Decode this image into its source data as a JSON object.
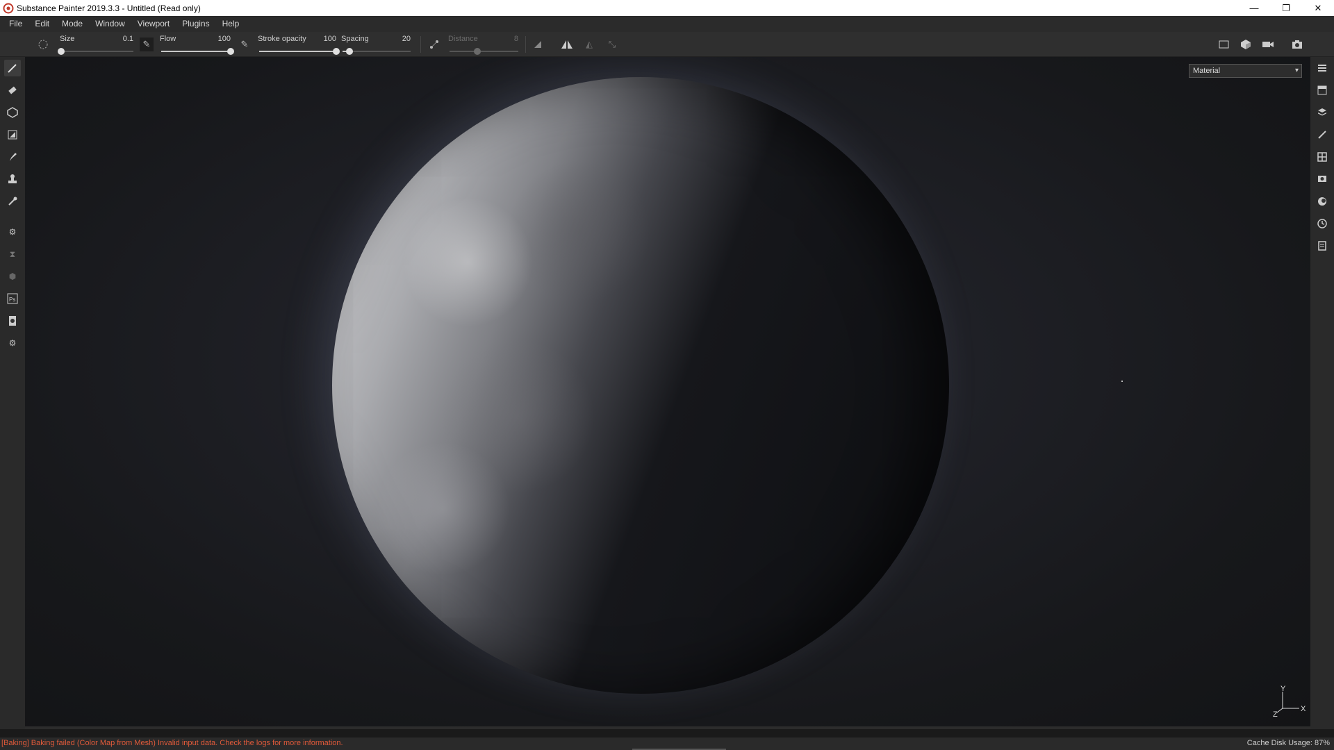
{
  "window": {
    "title": "Substance Painter 2019.3.3 - Untitled (Read only)",
    "minimize": "—",
    "restore": "❐",
    "close": "✕"
  },
  "menu": [
    "File",
    "Edit",
    "Mode",
    "Window",
    "Viewport",
    "Plugins",
    "Help"
  ],
  "toolbar": {
    "size": {
      "label": "Size",
      "value": "0.1",
      "level": 0.0
    },
    "flow": {
      "label": "Flow",
      "value": "100",
      "level": 1.0
    },
    "stroke_opacity": {
      "label": "Stroke opacity",
      "value": "100",
      "level": 1.0
    },
    "spacing": {
      "label": "Spacing",
      "value": "20",
      "level": 0.1
    },
    "distance": {
      "label": "Distance",
      "value": "8",
      "level": 0.4,
      "disabled": true
    }
  },
  "viewport": {
    "material_select": "Material",
    "axis_x": "X",
    "axis_y": "Y",
    "axis_z": "Z"
  },
  "status": {
    "message": "[Baking] Baking failed (Color Map from Mesh) Invalid input data. Check the logs for more information.",
    "cache": "Cache Disk Usage:  87%"
  },
  "colors": {
    "error": "#e05a3a",
    "panel": "#2a2a2a",
    "titlebar": "#ffffff"
  },
  "left_tools": [
    "paint-brush-icon",
    "eraser-icon",
    "projection-icon",
    "polygon-fill-icon",
    "smudge-icon",
    "clone-icon",
    "color-picker-icon",
    "settings-icon",
    "bake-icon",
    "plugin-icon",
    "photoshop-icon",
    "export-icon",
    "gear-icon"
  ],
  "right_tools": [
    "layers-icon",
    "texture-set-icon",
    "stack-icon",
    "properties-icon",
    "shelf-icon",
    "display-icon",
    "environment-icon",
    "history-icon",
    "log-icon"
  ]
}
